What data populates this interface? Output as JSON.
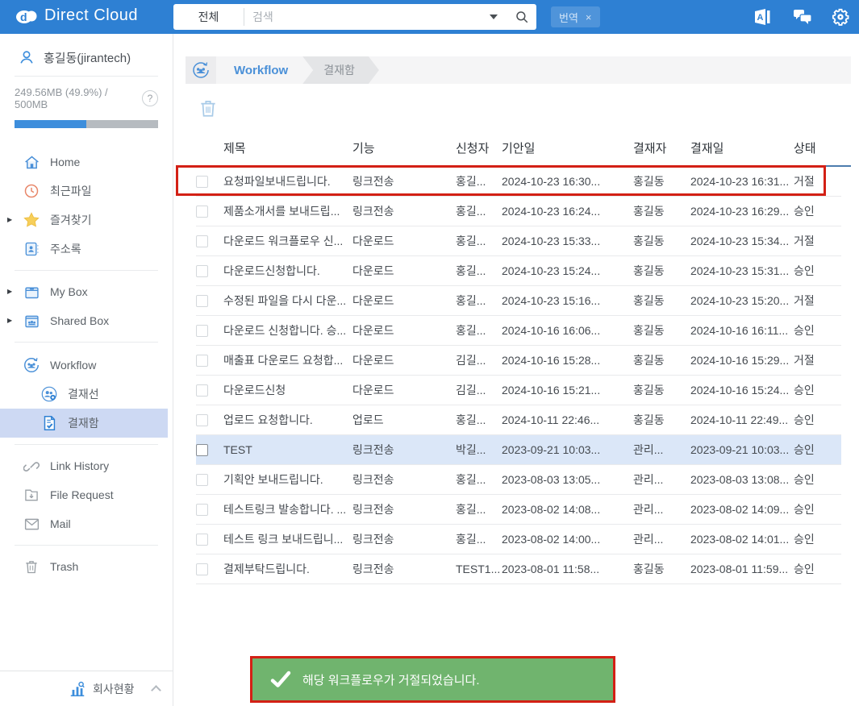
{
  "header": {
    "app_name": "Direct Cloud",
    "logo_icon": "cloud-logo-icon",
    "search": {
      "scope_label": "전체",
      "placeholder": "검색",
      "caret_icon": "caret-down-icon",
      "submit_icon": "search-icon"
    },
    "translate_tag": {
      "label": "번역",
      "close_label": "×"
    },
    "actions": [
      {
        "icon": "translator-icon"
      },
      {
        "icon": "chat-icon"
      },
      {
        "icon": "settings-gear-icon"
      }
    ]
  },
  "sidebar": {
    "user": {
      "name": "홍길동(jirantech)",
      "icon": "user-icon"
    },
    "quota": {
      "usage_text": "249.56MB (49.9%) / 500MB",
      "percent_used": 49.9,
      "help_label": "?",
      "help_icon": "question-icon"
    },
    "items": [
      {
        "label": "Home",
        "icon": "home-icon"
      },
      {
        "label": "최근파일",
        "icon": "recent-files-icon"
      },
      {
        "label": "즐겨찾기",
        "icon": "favorites-star-icon",
        "expandable": true
      },
      {
        "label": "주소록",
        "icon": "address-book-icon"
      },
      {
        "label": "My Box",
        "icon": "my-box-icon",
        "expandable": true
      },
      {
        "label": "Shared Box",
        "icon": "shared-box-icon",
        "expandable": true
      },
      {
        "label": "Workflow",
        "icon": "workflow-icon"
      },
      {
        "label": "결재선",
        "icon": "approval-line-icon",
        "child": true
      },
      {
        "label": "결재함",
        "icon": "approval-box-icon",
        "child": true,
        "selected": true
      },
      {
        "label": "Link History",
        "icon": "link-icon"
      },
      {
        "label": "File Request",
        "icon": "file-request-icon"
      },
      {
        "label": "Mail",
        "icon": "mail-icon"
      },
      {
        "label": "Trash",
        "icon": "trash-icon"
      }
    ],
    "company_status": {
      "label": "회사현황",
      "icon": "company-chart-icon",
      "collapse_icon": "chevron-up-icon"
    }
  },
  "breadcrumb": {
    "icon": "workflow-icon",
    "section": "Workflow",
    "page": "결재함"
  },
  "toolbar": {
    "delete_icon": "trash-icon"
  },
  "table": {
    "columns": [
      "제목",
      "기능",
      "신청자",
      "기안일",
      "결재자",
      "결재일",
      "상태"
    ],
    "rows": [
      {
        "title": "요청파일보내드립니다.",
        "func": "링크전송",
        "requester": "홍길...",
        "draft_date": "2024-10-23 16:30...",
        "approver": "홍길동",
        "approval_date": "2024-10-23 16:31...",
        "status": "거절",
        "annotated": true
      },
      {
        "title": "제품소개서를 보내드립...",
        "func": "링크전송",
        "requester": "홍길...",
        "draft_date": "2024-10-23 16:24...",
        "approver": "홍길동",
        "approval_date": "2024-10-23 16:29...",
        "status": "승인"
      },
      {
        "title": "다운로드 워크플로우 신...",
        "func": "다운로드",
        "requester": "홍길...",
        "draft_date": "2024-10-23 15:33...",
        "approver": "홍길동",
        "approval_date": "2024-10-23 15:34...",
        "status": "거절"
      },
      {
        "title": "다운로드신청합니다.",
        "func": "다운로드",
        "requester": "홍길...",
        "draft_date": "2024-10-23 15:24...",
        "approver": "홍길동",
        "approval_date": "2024-10-23 15:31...",
        "status": "승인"
      },
      {
        "title": "수정된 파일을 다시 다운...",
        "func": "다운로드",
        "requester": "홍길...",
        "draft_date": "2024-10-23 15:16...",
        "approver": "홍길동",
        "approval_date": "2024-10-23 15:20...",
        "status": "거절"
      },
      {
        "title": "다운로드 신청합니다. 승...",
        "func": "다운로드",
        "requester": "홍길...",
        "draft_date": "2024-10-16 16:06...",
        "approver": "홍길동",
        "approval_date": "2024-10-16 16:11...",
        "status": "승인"
      },
      {
        "title": "매출표 다운로드 요청합...",
        "func": "다운로드",
        "requester": "김길...",
        "draft_date": "2024-10-16 15:28...",
        "approver": "홍길동",
        "approval_date": "2024-10-16 15:29...",
        "status": "거절"
      },
      {
        "title": "다운로드신청",
        "func": "다운로드",
        "requester": "김길...",
        "draft_date": "2024-10-16 15:21...",
        "approver": "홍길동",
        "approval_date": "2024-10-16 15:24...",
        "status": "승인"
      },
      {
        "title": "업로드 요청합니다.",
        "func": "업로드",
        "requester": "홍길...",
        "draft_date": "2024-10-11 22:46...",
        "approver": "홍길동",
        "approval_date": "2024-10-11 22:49...",
        "status": "승인"
      },
      {
        "title": "TEST",
        "func": "링크전송",
        "requester": "박길...",
        "draft_date": "2023-09-21 10:03...",
        "approver": "관리...",
        "approval_date": "2023-09-21 10:03...",
        "status": "승인",
        "selected": true
      },
      {
        "title": "기획안 보내드립니다.",
        "func": "링크전송",
        "requester": "홍길...",
        "draft_date": "2023-08-03 13:05...",
        "approver": "관리...",
        "approval_date": "2023-08-03 13:08...",
        "status": "승인"
      },
      {
        "title": "테스트링크 발송합니다. ...",
        "func": "링크전송",
        "requester": "홍길...",
        "draft_date": "2023-08-02 14:08...",
        "approver": "관리...",
        "approval_date": "2023-08-02 14:09...",
        "status": "승인"
      },
      {
        "title": "테스트 링크 보내드립니...",
        "func": "링크전송",
        "requester": "홍길...",
        "draft_date": "2023-08-02 14:00...",
        "approver": "관리...",
        "approval_date": "2023-08-02 14:01...",
        "status": "승인"
      },
      {
        "title": "결제부탁드립니다.",
        "func": "링크전송",
        "requester": "TEST1...",
        "draft_date": "2023-08-01 11:58...",
        "approver": "홍길동",
        "approval_date": "2023-08-01 11:59...",
        "status": "승인"
      }
    ]
  },
  "toast": {
    "icon": "check-icon",
    "message": "해당 워크플로우가 거절되었습니다."
  },
  "colors": {
    "header_blue": "#2e80d3",
    "accent_blue": "#3d8edc",
    "selected_nav_bg": "#cdd9f3",
    "selected_row_bg": "#dbe7f8",
    "toast_green": "#70b46e",
    "annotation_red": "#d32015",
    "table_header_line": "#4c7cae"
  }
}
